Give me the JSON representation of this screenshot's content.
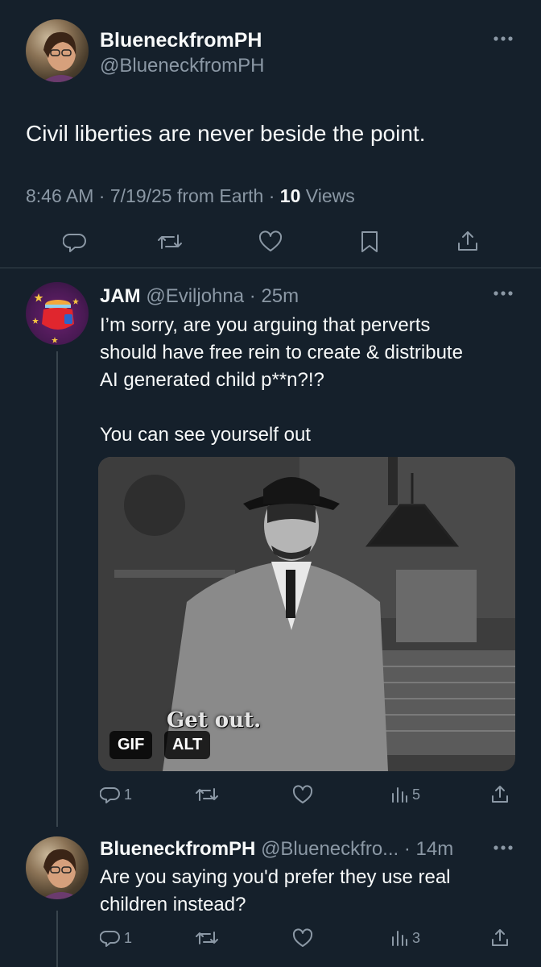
{
  "main_post": {
    "display_name": "BlueneckfromPH",
    "handle": "@BlueneckfromPH",
    "text": "Civil liberties are never beside the point.",
    "time": "8:46 AM",
    "date": "7/19/25 from Earth",
    "views_count": "10",
    "views_label": "Views"
  },
  "reply1": {
    "display_name": "JAM",
    "handle": "@Eviljohna",
    "time": "25m",
    "text_line1": "I’m sorry, are you arguing that perverts",
    "text_line2": "should have free rein to create & distribute",
    "text_line3": "AI generated child p**n?!?",
    "text_line4": "You can see yourself out",
    "gif_caption": "Get out.",
    "gif_badge": "GIF",
    "alt_badge": "ALT",
    "reply_count": "1",
    "views_count": "5"
  },
  "reply2": {
    "display_name": "BlueneckfromPH",
    "handle": "@Blueneckfro...",
    "time": "14m",
    "text_line1": "Are you saying you'd prefer they use real",
    "text_line2": "children instead?",
    "reply_count": "1",
    "views_count": "3"
  },
  "colors": {
    "background": "#15202b",
    "text": "#f7f9f9",
    "muted": "#8b98a5",
    "divider": "#38444d"
  }
}
